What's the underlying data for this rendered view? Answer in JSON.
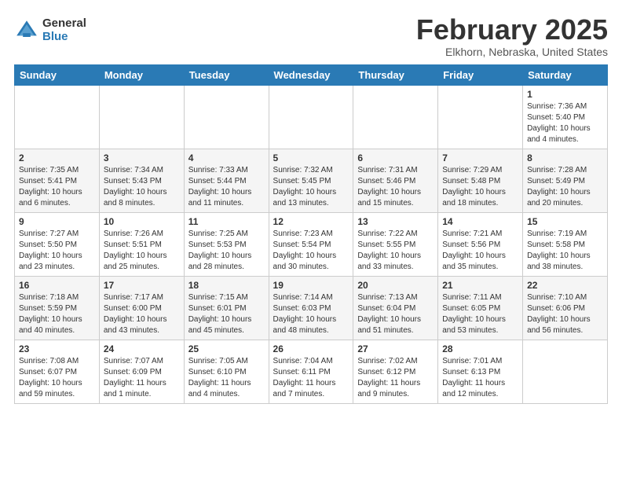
{
  "header": {
    "logo_general": "General",
    "logo_blue": "Blue",
    "month_title": "February 2025",
    "location": "Elkhorn, Nebraska, United States"
  },
  "days_of_week": [
    "Sunday",
    "Monday",
    "Tuesday",
    "Wednesday",
    "Thursday",
    "Friday",
    "Saturday"
  ],
  "weeks": [
    [
      {
        "day": "",
        "info": ""
      },
      {
        "day": "",
        "info": ""
      },
      {
        "day": "",
        "info": ""
      },
      {
        "day": "",
        "info": ""
      },
      {
        "day": "",
        "info": ""
      },
      {
        "day": "",
        "info": ""
      },
      {
        "day": "1",
        "info": "Sunrise: 7:36 AM\nSunset: 5:40 PM\nDaylight: 10 hours\nand 4 minutes."
      }
    ],
    [
      {
        "day": "2",
        "info": "Sunrise: 7:35 AM\nSunset: 5:41 PM\nDaylight: 10 hours\nand 6 minutes."
      },
      {
        "day": "3",
        "info": "Sunrise: 7:34 AM\nSunset: 5:43 PM\nDaylight: 10 hours\nand 8 minutes."
      },
      {
        "day": "4",
        "info": "Sunrise: 7:33 AM\nSunset: 5:44 PM\nDaylight: 10 hours\nand 11 minutes."
      },
      {
        "day": "5",
        "info": "Sunrise: 7:32 AM\nSunset: 5:45 PM\nDaylight: 10 hours\nand 13 minutes."
      },
      {
        "day": "6",
        "info": "Sunrise: 7:31 AM\nSunset: 5:46 PM\nDaylight: 10 hours\nand 15 minutes."
      },
      {
        "day": "7",
        "info": "Sunrise: 7:29 AM\nSunset: 5:48 PM\nDaylight: 10 hours\nand 18 minutes."
      },
      {
        "day": "8",
        "info": "Sunrise: 7:28 AM\nSunset: 5:49 PM\nDaylight: 10 hours\nand 20 minutes."
      }
    ],
    [
      {
        "day": "9",
        "info": "Sunrise: 7:27 AM\nSunset: 5:50 PM\nDaylight: 10 hours\nand 23 minutes."
      },
      {
        "day": "10",
        "info": "Sunrise: 7:26 AM\nSunset: 5:51 PM\nDaylight: 10 hours\nand 25 minutes."
      },
      {
        "day": "11",
        "info": "Sunrise: 7:25 AM\nSunset: 5:53 PM\nDaylight: 10 hours\nand 28 minutes."
      },
      {
        "day": "12",
        "info": "Sunrise: 7:23 AM\nSunset: 5:54 PM\nDaylight: 10 hours\nand 30 minutes."
      },
      {
        "day": "13",
        "info": "Sunrise: 7:22 AM\nSunset: 5:55 PM\nDaylight: 10 hours\nand 33 minutes."
      },
      {
        "day": "14",
        "info": "Sunrise: 7:21 AM\nSunset: 5:56 PM\nDaylight: 10 hours\nand 35 minutes."
      },
      {
        "day": "15",
        "info": "Sunrise: 7:19 AM\nSunset: 5:58 PM\nDaylight: 10 hours\nand 38 minutes."
      }
    ],
    [
      {
        "day": "16",
        "info": "Sunrise: 7:18 AM\nSunset: 5:59 PM\nDaylight: 10 hours\nand 40 minutes."
      },
      {
        "day": "17",
        "info": "Sunrise: 7:17 AM\nSunset: 6:00 PM\nDaylight: 10 hours\nand 43 minutes."
      },
      {
        "day": "18",
        "info": "Sunrise: 7:15 AM\nSunset: 6:01 PM\nDaylight: 10 hours\nand 45 minutes."
      },
      {
        "day": "19",
        "info": "Sunrise: 7:14 AM\nSunset: 6:03 PM\nDaylight: 10 hours\nand 48 minutes."
      },
      {
        "day": "20",
        "info": "Sunrise: 7:13 AM\nSunset: 6:04 PM\nDaylight: 10 hours\nand 51 minutes."
      },
      {
        "day": "21",
        "info": "Sunrise: 7:11 AM\nSunset: 6:05 PM\nDaylight: 10 hours\nand 53 minutes."
      },
      {
        "day": "22",
        "info": "Sunrise: 7:10 AM\nSunset: 6:06 PM\nDaylight: 10 hours\nand 56 minutes."
      }
    ],
    [
      {
        "day": "23",
        "info": "Sunrise: 7:08 AM\nSunset: 6:07 PM\nDaylight: 10 hours\nand 59 minutes."
      },
      {
        "day": "24",
        "info": "Sunrise: 7:07 AM\nSunset: 6:09 PM\nDaylight: 11 hours\nand 1 minute."
      },
      {
        "day": "25",
        "info": "Sunrise: 7:05 AM\nSunset: 6:10 PM\nDaylight: 11 hours\nand 4 minutes."
      },
      {
        "day": "26",
        "info": "Sunrise: 7:04 AM\nSunset: 6:11 PM\nDaylight: 11 hours\nand 7 minutes."
      },
      {
        "day": "27",
        "info": "Sunrise: 7:02 AM\nSunset: 6:12 PM\nDaylight: 11 hours\nand 9 minutes."
      },
      {
        "day": "28",
        "info": "Sunrise: 7:01 AM\nSunset: 6:13 PM\nDaylight: 11 hours\nand 12 minutes."
      },
      {
        "day": "",
        "info": ""
      }
    ]
  ]
}
